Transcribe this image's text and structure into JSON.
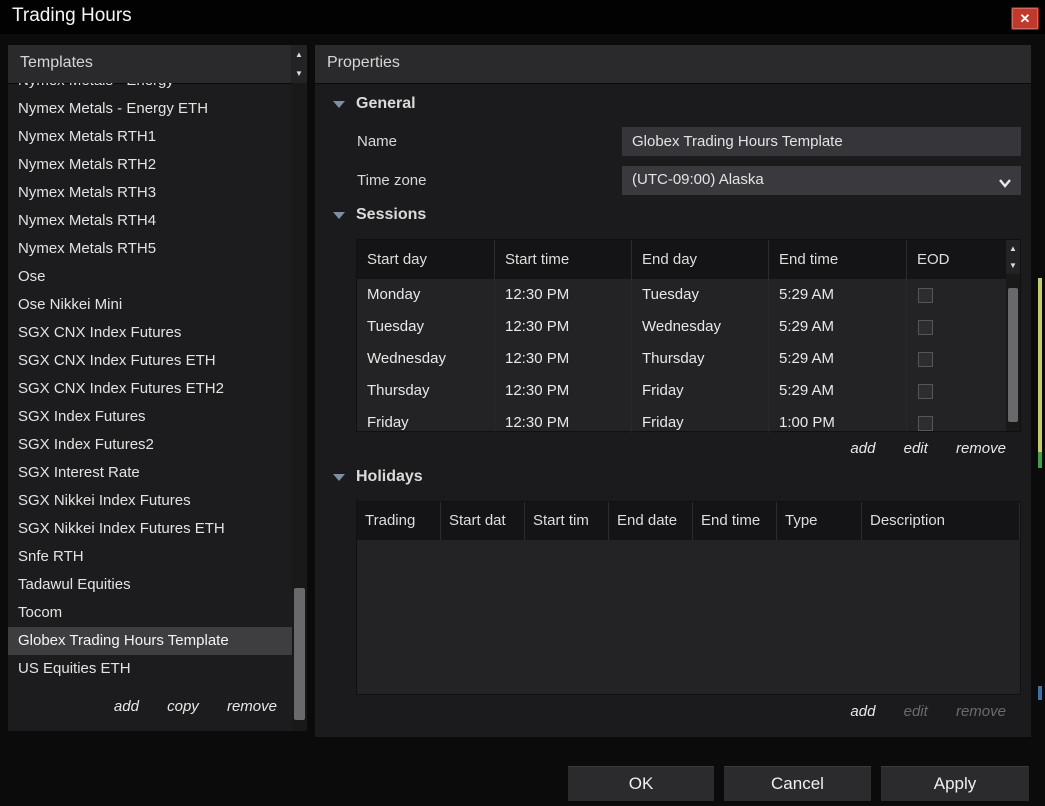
{
  "window": {
    "title": "Trading Hours"
  },
  "icons": {
    "close": "✕",
    "scroll_up": "▲",
    "scroll_down": "▼"
  },
  "colors": {
    "close_button_red": "#c0392b",
    "section_arrow": "#7b90a5",
    "selected_item_bg": "#3e3e41"
  },
  "templates": {
    "header": "Templates",
    "items": [
      "Nymex Metals - Energy",
      "Nymex Metals - Energy ETH",
      "Nymex Metals RTH1",
      "Nymex Metals RTH2",
      "Nymex Metals RTH3",
      "Nymex Metals RTH4",
      "Nymex Metals RTH5",
      "Ose",
      "Ose Nikkei Mini",
      "SGX CNX Index Futures",
      "SGX CNX Index Futures ETH",
      "SGX CNX Index Futures ETH2",
      "SGX Index Futures",
      "SGX Index Futures2",
      "SGX Interest Rate",
      "SGX Nikkei Index Futures",
      "SGX Nikkei Index Futures ETH",
      "Snfe RTH",
      "Tadawul Equities",
      "Tocom",
      "Globex Trading Hours Template",
      "US Equities ETH"
    ],
    "selected_item": "Globex Trading Hours Template",
    "actions": {
      "add": "add",
      "copy": "copy",
      "remove": "remove"
    }
  },
  "properties": {
    "header": "Properties",
    "general": {
      "title": "General",
      "name_label": "Name",
      "name_value": "Globex Trading Hours Template",
      "timezone_label": "Time zone",
      "timezone_value": "(UTC-09:00) Alaska"
    },
    "sessions": {
      "title": "Sessions",
      "columns": [
        "Start day",
        "Start time",
        "End day",
        "End time",
        "EOD"
      ],
      "rows": [
        {
          "start_day": "Monday",
          "start_time": "12:30 PM",
          "end_day": "Tuesday",
          "end_time": "5:29 AM",
          "eod": false
        },
        {
          "start_day": "Tuesday",
          "start_time": "12:30 PM",
          "end_day": "Wednesday",
          "end_time": "5:29 AM",
          "eod": false
        },
        {
          "start_day": "Wednesday",
          "start_time": "12:30 PM",
          "end_day": "Thursday",
          "end_time": "5:29 AM",
          "eod": false
        },
        {
          "start_day": "Thursday",
          "start_time": "12:30 PM",
          "end_day": "Friday",
          "end_time": "5:29 AM",
          "eod": false
        },
        {
          "start_day": "Friday",
          "start_time": "12:30 PM",
          "end_day": "Friday",
          "end_time": "1:00 PM",
          "eod": false
        }
      ],
      "actions": {
        "add": "add",
        "edit": "edit",
        "remove": "remove"
      },
      "disabled_actions": []
    },
    "holidays": {
      "title": "Holidays",
      "columns": [
        "Trading",
        "Start dat",
        "Start tim",
        "End date",
        "End time",
        "Type",
        "Description"
      ],
      "rows": [],
      "actions": {
        "add": "add",
        "edit": "edit",
        "remove": "remove"
      },
      "disabled_actions": [
        "edit",
        "remove"
      ]
    }
  },
  "footer": {
    "ok": "OK",
    "cancel": "Cancel",
    "apply": "Apply"
  }
}
